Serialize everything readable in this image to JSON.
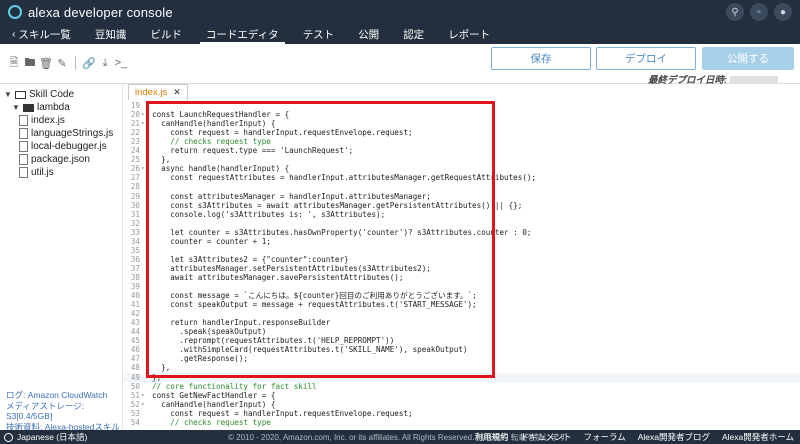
{
  "app": {
    "title": "alexa developer console"
  },
  "header": {
    "icons": [
      "search-icon",
      "help-icon",
      "account-icon"
    ]
  },
  "nav": {
    "back_label": "スキル一覧",
    "items": [
      "豆知識",
      "ビルド",
      "コードエディタ",
      "テスト",
      "公開",
      "認定",
      "レポート"
    ],
    "active": "コードエディタ"
  },
  "toolbar": {
    "icons": [
      "new-file-icon",
      "new-folder-icon",
      "delete-icon",
      "edit-icon",
      "link-icon",
      "download-icon",
      "terminal-icon"
    ],
    "save_label": "保存",
    "deploy_label": "デプロイ",
    "publish_label": "公開する",
    "last_deploy_label": "最終デプロイ日時:"
  },
  "file_tree": {
    "root": "Skill Code",
    "folder": "lambda",
    "files": [
      "index.js",
      "languageStrings.js",
      "local-debugger.js",
      "package.json",
      "util.js"
    ]
  },
  "sidebar_footer": {
    "log": "ログ: Amazon CloudWatch",
    "storage": "メディアストレージ: S3[0.4/5GB]",
    "resource": "技術資料: Alexa-hostedスキル"
  },
  "editor": {
    "tab_label": "index.js",
    "lines": [
      {
        "n": "19",
        "code": ""
      },
      {
        "n": "20",
        "code": "const LaunchRequestHandler = {"
      },
      {
        "n": "21",
        "code": "  canHandle(handlerInput) {"
      },
      {
        "n": "22",
        "code": "    const request = handlerInput.requestEnvelope.request;"
      },
      {
        "n": "23",
        "code": "    // checks request type"
      },
      {
        "n": "24",
        "code": "    return request.type === 'LaunchRequest';"
      },
      {
        "n": "25",
        "code": "  },"
      },
      {
        "n": "26",
        "code": "  async handle(handlerInput) {"
      },
      {
        "n": "27",
        "code": "    const requestAttributes = handlerInput.attributesManager.getRequestAttributes();"
      },
      {
        "n": "28",
        "code": ""
      },
      {
        "n": "29",
        "code": "    const attributesManager = handlerInput.attributesManager;"
      },
      {
        "n": "30",
        "code": "    const s3Attributes = await attributesManager.getPersistentAttributes() || {};"
      },
      {
        "n": "31",
        "code": "    console.log('s3Attributes is: ', s3Attributes);"
      },
      {
        "n": "32",
        "code": ""
      },
      {
        "n": "33",
        "code": "    let counter = s3Attributes.hasOwnProperty('counter')? s3Attributes.counter : 0;"
      },
      {
        "n": "34",
        "code": "    counter = counter + 1;"
      },
      {
        "n": "35",
        "code": ""
      },
      {
        "n": "36",
        "code": "    let s3Attributes2 = {\"counter\":counter}"
      },
      {
        "n": "37",
        "code": "    attributesManager.setPersistentAttributes(s3Attributes2);"
      },
      {
        "n": "38",
        "code": "    await attributesManager.savePersistentAttributes();"
      },
      {
        "n": "39",
        "code": ""
      },
      {
        "n": "40",
        "code": "    const message = `こんにちは。${counter}回目のご利用ありがとうございます。`;"
      },
      {
        "n": "41",
        "code": "    const speakOutput = message + requestAttributes.t('START_MESSAGE');"
      },
      {
        "n": "42",
        "code": ""
      },
      {
        "n": "43",
        "code": "    return handlerInput.responseBuilder"
      },
      {
        "n": "44",
        "code": "      .speak(speakOutput)"
      },
      {
        "n": "45",
        "code": "      .reprompt(requestAttributes.t('HELP_REPROMPT'))"
      },
      {
        "n": "46",
        "code": "      .withSimpleCard(requestAttributes.t('SKILL_NAME'), speakOutput)"
      },
      {
        "n": "47",
        "code": "      .getResponse();"
      },
      {
        "n": "48",
        "code": "  },"
      },
      {
        "n": "49",
        "code": "};"
      },
      {
        "n": "50",
        "code": "// core functionality for fact skill"
      },
      {
        "n": "51",
        "code": "const GetNewFactHandler = {"
      },
      {
        "n": "52",
        "code": "  canHandle(handlerInput) {"
      },
      {
        "n": "53",
        "code": "    const request = handlerInput.requestEnvelope.request;"
      },
      {
        "n": "54",
        "code": "    // checks request type"
      }
    ]
  },
  "footer": {
    "language": "Japanese (日本語)",
    "copyright": "© 2010 - 2020, Amazon.com, Inc. or its affiliates. All Rights Reserved. 無断複写 転載を禁じます",
    "links": [
      "利用規約",
      "ドキュメント",
      "フォーラム",
      "Alexa開発者ブログ",
      "Alexa開発者ホーム"
    ]
  },
  "colors": {
    "nav_bg": "#232f3e",
    "highlight_border": "#e0151b",
    "accent": "#4a88c2"
  }
}
